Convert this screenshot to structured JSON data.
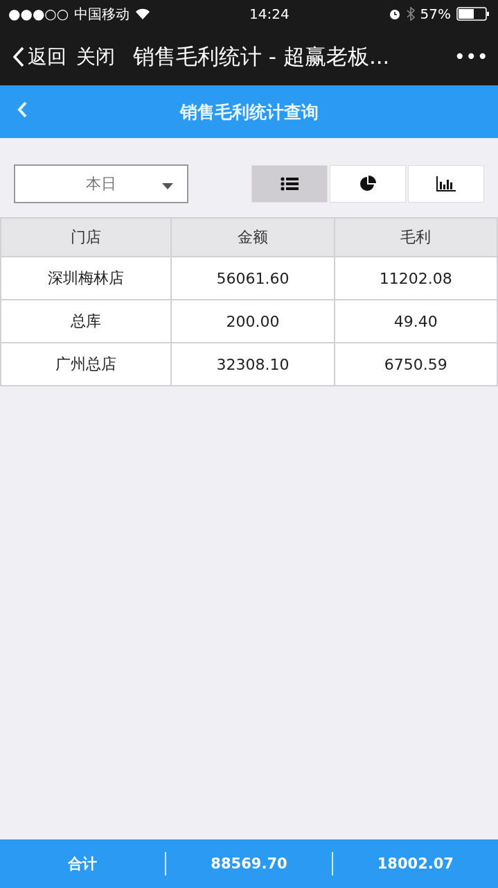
{
  "status_bar": {
    "signal": "●●●○○",
    "carrier": "中国移动",
    "time": "14:24",
    "battery": "57%"
  },
  "nav_bar": {
    "back": "返回",
    "close": "关闭",
    "title": "销售毛利统计 - 超赢老板...",
    "more": "•••"
  },
  "header": {
    "title": "销售毛利统计查询"
  },
  "period_select": {
    "value": "本日"
  },
  "view_buttons": [
    {
      "kind": "list",
      "selected": true
    },
    {
      "kind": "pie",
      "selected": false
    },
    {
      "kind": "bar",
      "selected": false
    }
  ],
  "table": {
    "columns": [
      "门店",
      "金额",
      "毛利"
    ],
    "rows": [
      [
        "深圳梅林店",
        "56061.60",
        "11202.08"
      ],
      [
        "总库",
        "200.00",
        "49.40"
      ],
      [
        "广州总店",
        "32308.10",
        "6750.59"
      ]
    ]
  },
  "footer": {
    "label": "合计",
    "amount": "88569.70",
    "profit": "18002.07"
  }
}
